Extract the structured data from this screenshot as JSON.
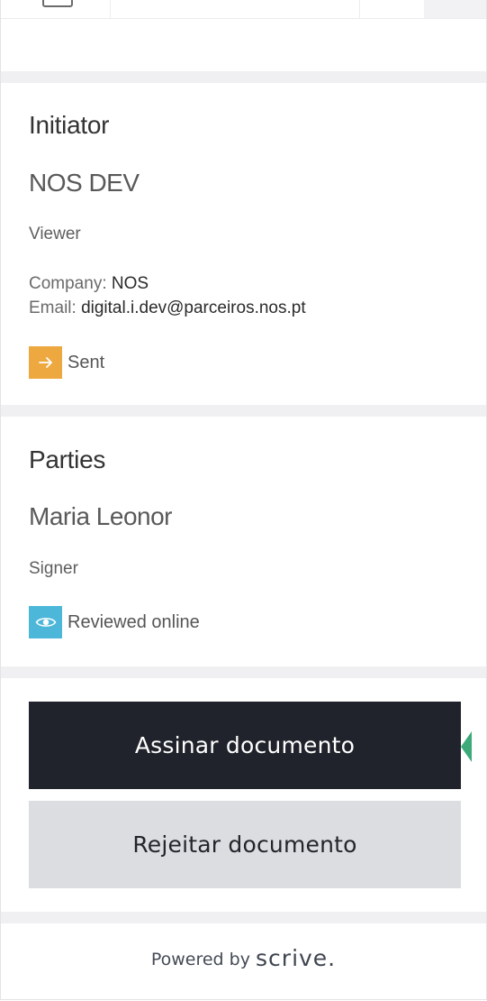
{
  "initiator": {
    "heading": "Initiator",
    "name": "NOS DEV",
    "role": "Viewer",
    "company_label": "Company:",
    "company_value": "NOS",
    "email_label": "Email:",
    "email_value": "digital.i.dev@parceiros.nos.pt",
    "status": {
      "label": "Sent",
      "icon": "arrow-right-icon",
      "color": "#eda83f"
    }
  },
  "parties": {
    "heading": "Parties",
    "name": "Maria Leonor",
    "role": "Signer",
    "status": {
      "label": "Reviewed online",
      "icon": "eye-icon",
      "color": "#4cb7d9"
    }
  },
  "actions": {
    "sign_label": "Assinar documento",
    "reject_label": "Rejeitar documento"
  },
  "footer": {
    "powered_by": "Powered by",
    "brand": "scrive."
  },
  "colors": {
    "sign_button": "#20232b",
    "reject_button": "#dcdde1",
    "arrow_tab": "#3daa7a"
  }
}
